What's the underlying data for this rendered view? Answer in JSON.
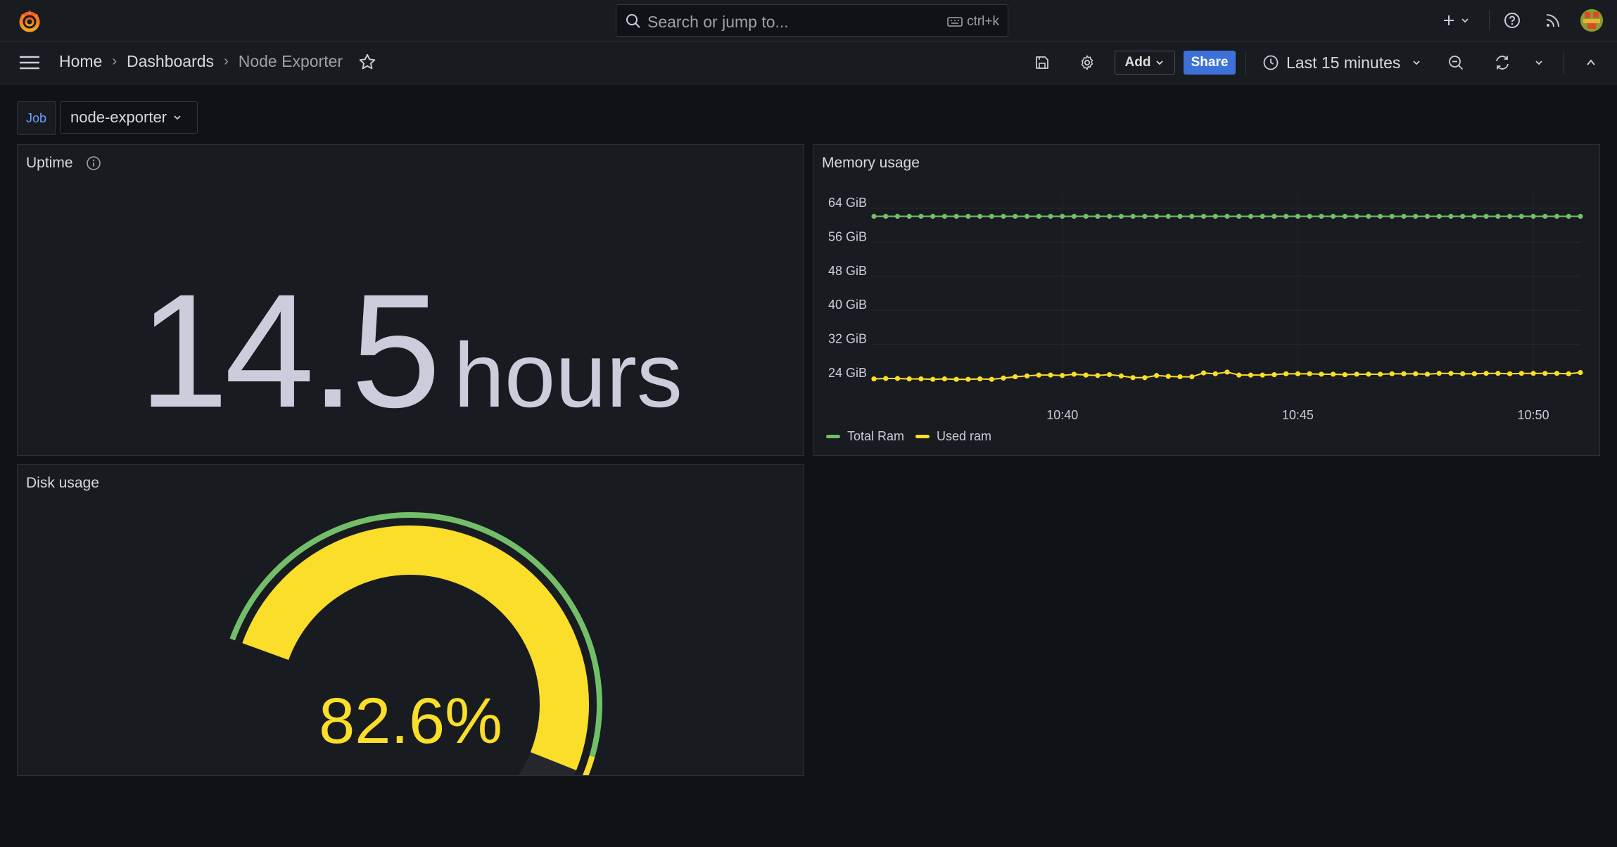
{
  "search": {
    "placeholder": "Search or jump to...",
    "shortcut": "ctrl+k"
  },
  "breadcrumb": {
    "home": "Home",
    "dashboards": "Dashboards",
    "current": "Node Exporter"
  },
  "toolbar": {
    "add_label": "Add",
    "share_label": "Share",
    "time_range": "Last 15 minutes"
  },
  "variables": {
    "job_label": "Job",
    "job_value": "node-exporter"
  },
  "panels": {
    "uptime": {
      "title": "Uptime",
      "value": "14.5",
      "unit": "hours"
    },
    "memory": {
      "title": "Memory usage"
    },
    "disk": {
      "title": "Disk usage",
      "value": "82.6%"
    }
  },
  "colors": {
    "green": "#73bf69",
    "yellow": "#fade2a",
    "red": "#f2495c",
    "accent": "#3d71d9",
    "background": "#111217",
    "panel": "#181b1f"
  },
  "icons": [
    "grafana-logo-icon",
    "search-icon",
    "keyboard-icon",
    "plus-icon",
    "help-icon",
    "news-icon",
    "avatar",
    "menu-icon",
    "star-icon",
    "save-icon",
    "settings-icon",
    "clock-icon",
    "zoom-out-icon",
    "refresh-icon",
    "collapse-icon",
    "info-icon"
  ],
  "chart_data": {
    "type": "line",
    "title": "Memory usage",
    "xlabel": "",
    "ylabel": "",
    "x_ticks": [
      "10:40",
      "10:45",
      "10:50"
    ],
    "y_ticks": [
      "24 GiB",
      "32 GiB",
      "40 GiB",
      "48 GiB",
      "56 GiB",
      "64 GiB"
    ],
    "ylim": [
      24,
      64
    ],
    "grid": true,
    "legend": "bottom-left",
    "x_start_label": "10:35:45",
    "x_end_label": "10:51:00",
    "series": [
      {
        "name": "Total Ram",
        "color": "#73bf69",
        "values": [
          62.1,
          62.1,
          62.1,
          62.1,
          62.1,
          62.1,
          62.1,
          62.1,
          62.1,
          62.1,
          62.1,
          62.1,
          62.1,
          62.1,
          62.1,
          62.1,
          62.1,
          62.1,
          62.1,
          62.1,
          62.1,
          62.1,
          62.1,
          62.1,
          62.1,
          62.1,
          62.1,
          62.1,
          62.1,
          62.1,
          62.1,
          62.1,
          62.1,
          62.1,
          62.1,
          62.1,
          62.1,
          62.1,
          62.1,
          62.1,
          62.1,
          62.1,
          62.1,
          62.1,
          62.1,
          62.1,
          62.1,
          62.1,
          62.1,
          62.1,
          62.1,
          62.1,
          62.1,
          62.1,
          62.1,
          62.1,
          62.1,
          62.1,
          62.1,
          62.1,
          62.1
        ]
      },
      {
        "name": "Used ram",
        "color": "#fade2a",
        "values": [
          23.9,
          24.0,
          24.0,
          23.9,
          23.9,
          23.8,
          23.9,
          23.8,
          23.8,
          23.9,
          23.8,
          24.1,
          24.4,
          24.6,
          24.8,
          24.8,
          24.7,
          25.0,
          24.8,
          24.7,
          24.9,
          24.6,
          24.2,
          24.2,
          24.7,
          24.5,
          24.4,
          24.4,
          25.3,
          25.1,
          25.5,
          24.8,
          24.8,
          24.8,
          24.9,
          25.1,
          25.1,
          25.1,
          25.0,
          25.0,
          24.9,
          25.0,
          25.0,
          25.0,
          25.1,
          25.1,
          25.1,
          25.0,
          25.2,
          25.2,
          25.1,
          25.1,
          25.2,
          25.2,
          25.1,
          25.2,
          25.2,
          25.2,
          25.2,
          25.1,
          25.4
        ]
      }
    ]
  },
  "gauge_data": {
    "value": 82.6,
    "min": 0,
    "max": 100,
    "thresholds": [
      {
        "color": "#73bf69",
        "to": 80
      },
      {
        "color": "#fade2a",
        "to": 90
      },
      {
        "color": "#f2495c",
        "to": 100
      }
    ]
  }
}
